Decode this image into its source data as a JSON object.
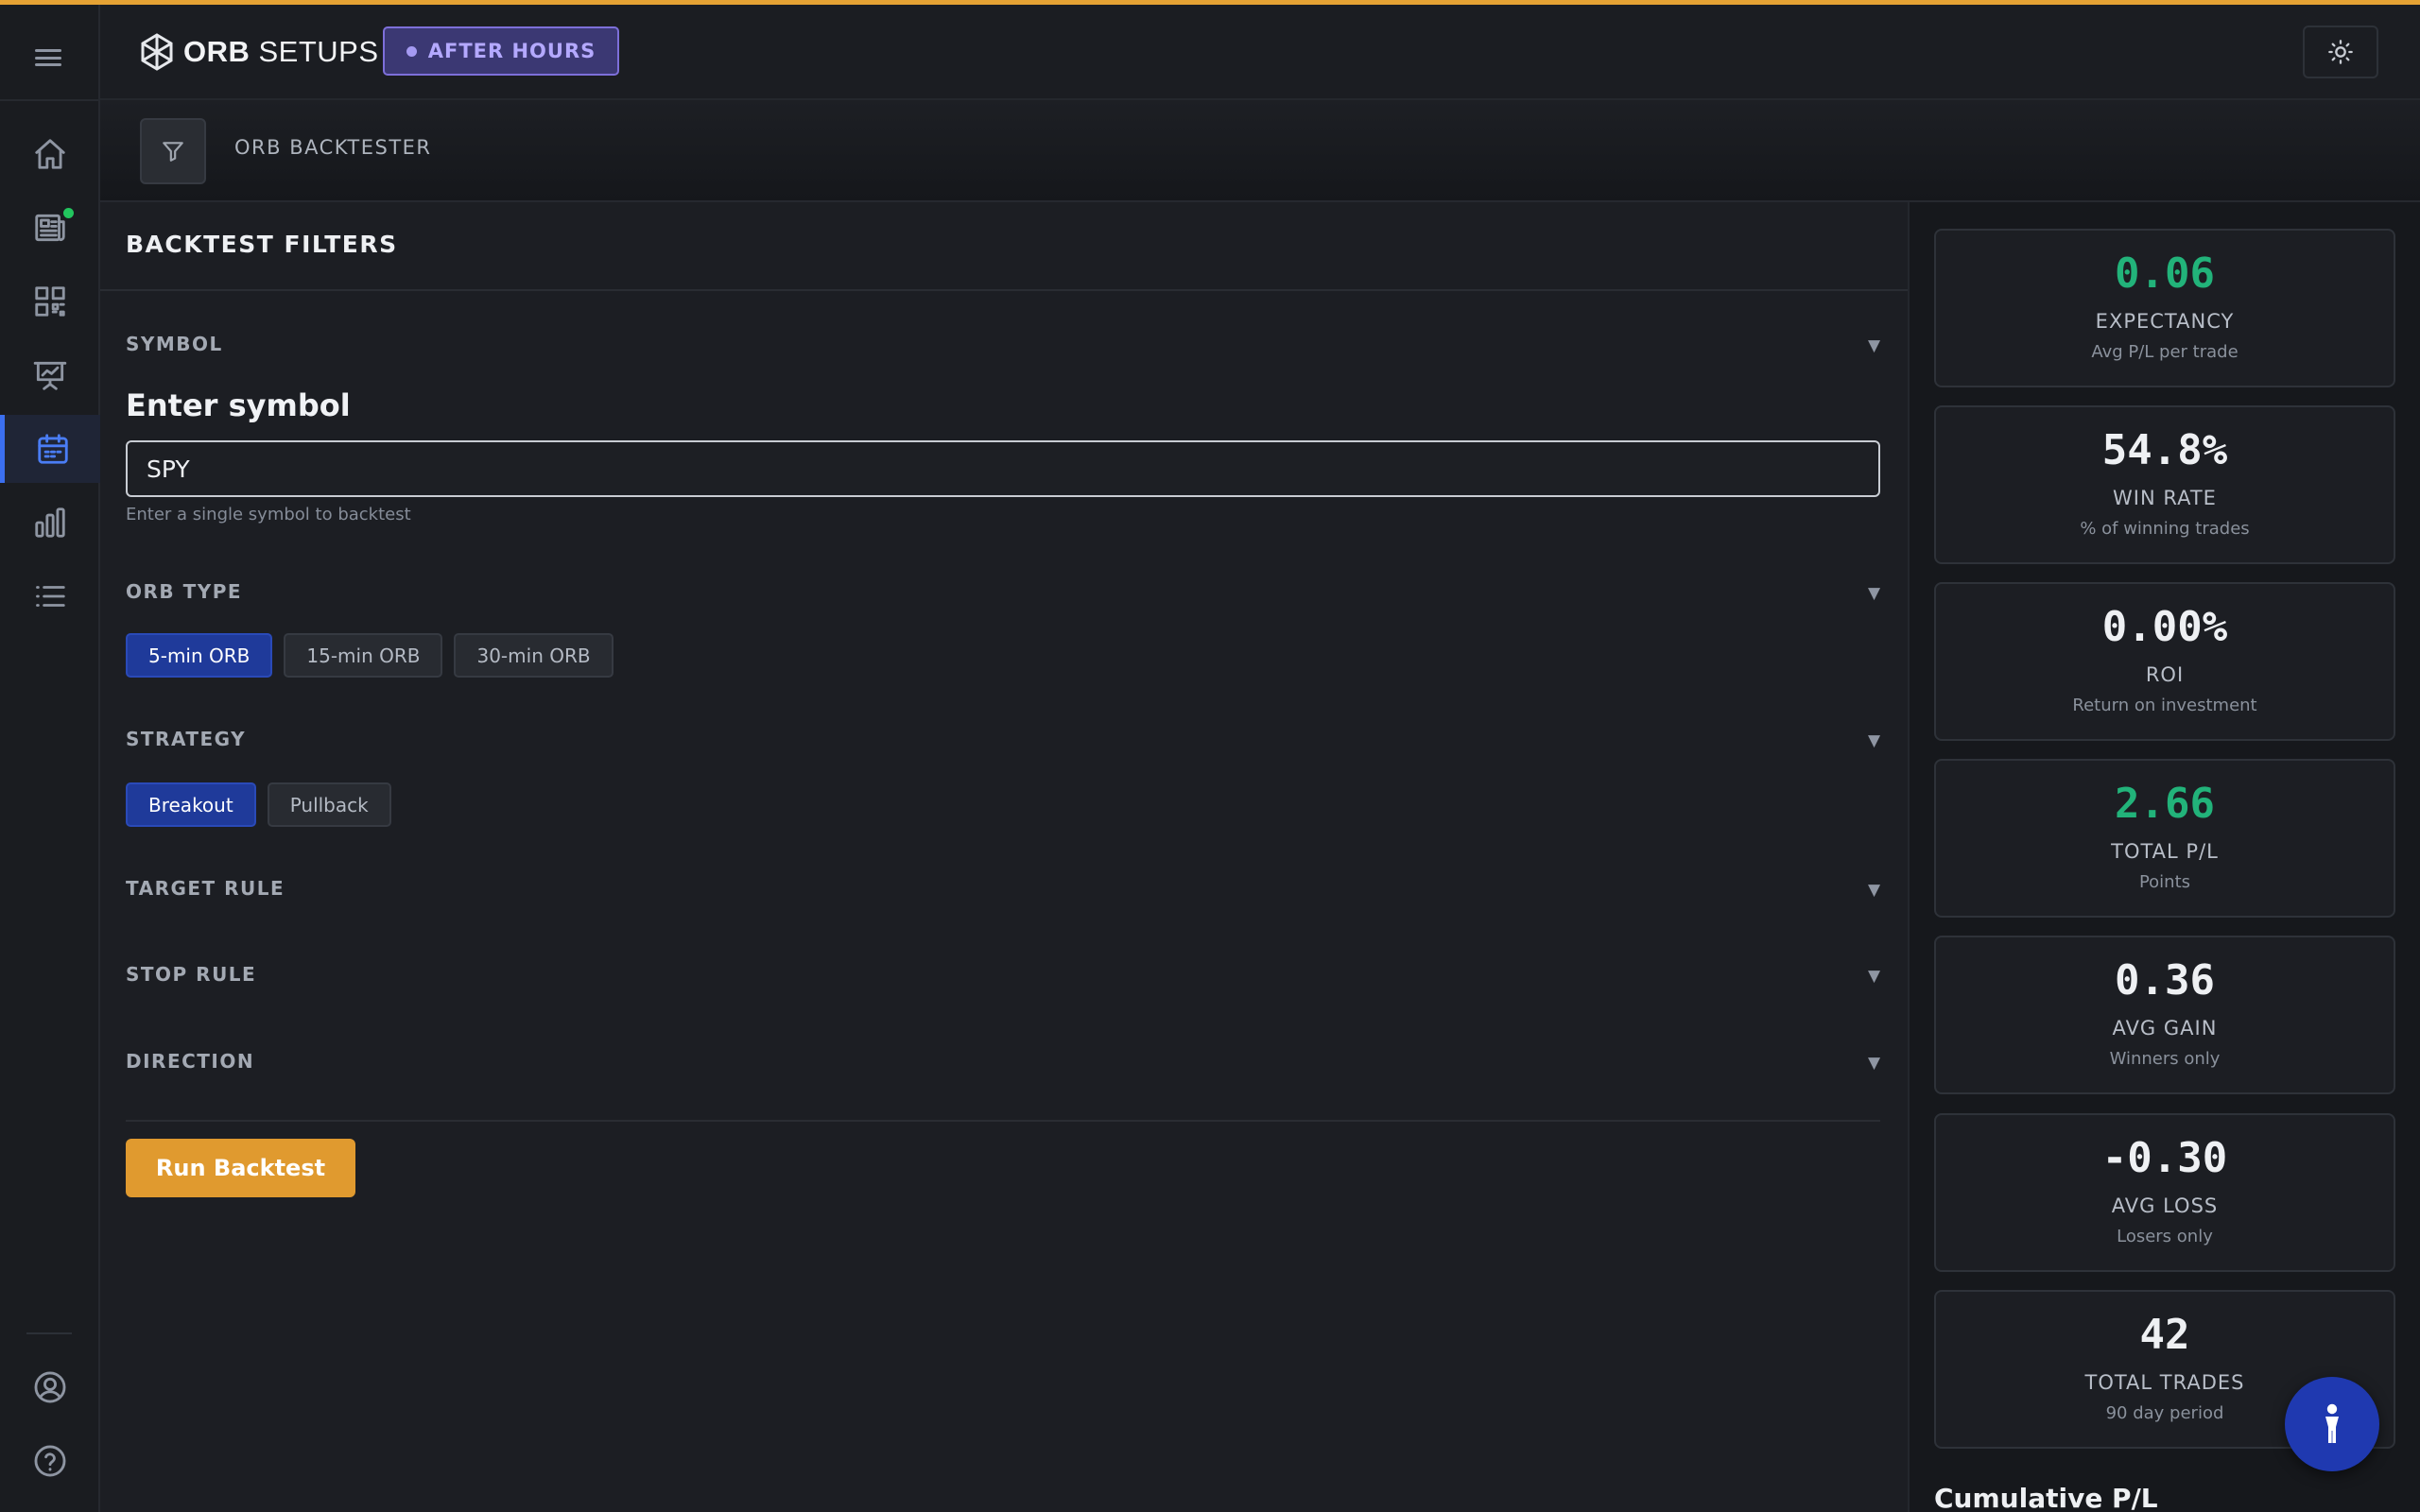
{
  "app": {
    "logo_bold": "ORB",
    "logo_light": " SETUPS",
    "market_status": "AFTER HOURS",
    "accent_color": "#e5a234"
  },
  "sidebar": {
    "items": [
      {
        "name": "home",
        "icon": "home-icon"
      },
      {
        "name": "news",
        "icon": "newspaper-icon",
        "notification": true
      },
      {
        "name": "scanner",
        "icon": "qr-grid-icon"
      },
      {
        "name": "presentation",
        "icon": "chart-board-icon"
      },
      {
        "name": "calendar",
        "icon": "calendar-icon",
        "active": true
      },
      {
        "name": "stats",
        "icon": "bar-chart-icon"
      },
      {
        "name": "list",
        "icon": "list-icon"
      }
    ],
    "bottom": [
      {
        "name": "account",
        "icon": "user-circle-icon"
      },
      {
        "name": "help",
        "icon": "help-circle-icon"
      }
    ]
  },
  "breadcrumb": {
    "title": "ORB BACKTESTER"
  },
  "filters": {
    "title": "BACKTEST FILTERS",
    "symbol_section": "SYMBOL",
    "symbol_label": "Enter symbol",
    "symbol_value": "SPY",
    "symbol_helper": "Enter a single symbol to backtest",
    "orb_type_section": "ORB TYPE",
    "orb_types": [
      "5-min ORB",
      "15-min ORB",
      "30-min ORB"
    ],
    "orb_type_selected": "5-min ORB",
    "strategy_section": "STRATEGY",
    "strategies": [
      "Breakout",
      "Pullback"
    ],
    "strategy_selected": "Breakout",
    "target_rule_section": "TARGET RULE",
    "stop_rule_section": "STOP RULE",
    "direction_section": "DIRECTION",
    "run_button": "Run Backtest",
    "caret": "▼"
  },
  "stats": [
    {
      "value": "0.06",
      "label": "EXPECTANCY",
      "sub": "Avg P/L per trade",
      "color": "green"
    },
    {
      "value": "54.8%",
      "label": "WIN RATE",
      "sub": "% of winning trades",
      "color": "white"
    },
    {
      "value": "0.00%",
      "label": "ROI",
      "sub": "Return on investment",
      "color": "white"
    },
    {
      "value": "2.66",
      "label": "TOTAL P/L",
      "sub": "Points",
      "color": "green"
    },
    {
      "value": "0.36",
      "label": "AVG GAIN",
      "sub": "Winners only",
      "color": "white"
    },
    {
      "value": "-0.30",
      "label": "AVG LOSS",
      "sub": "Losers only",
      "color": "white"
    },
    {
      "value": "42",
      "label": "TOTAL TRADES",
      "sub": "90 day period",
      "color": "white"
    }
  ],
  "cumulative_title": "Cumulative P/L"
}
